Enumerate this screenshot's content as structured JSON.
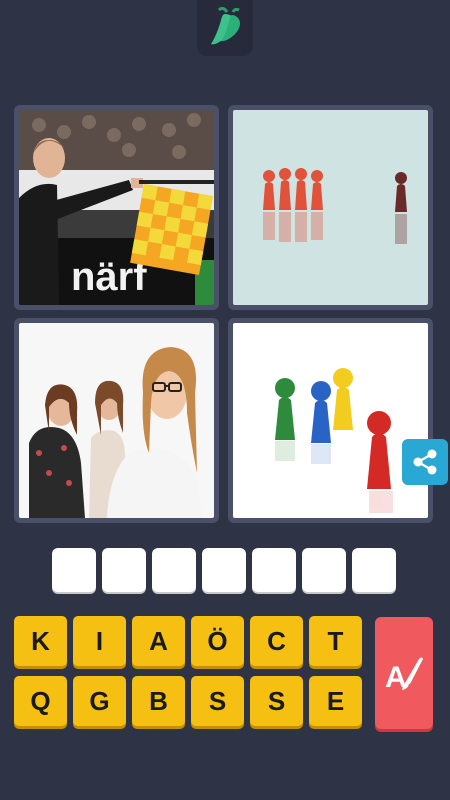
{
  "header": {
    "icon": "chili-pepper-icon"
  },
  "images": [
    {
      "name": "referee-with-flag"
    },
    {
      "name": "red-pawns-and-one-brown-pawn"
    },
    {
      "name": "girl-with-glasses-and-two-girls"
    },
    {
      "name": "colored-game-pawns"
    }
  ],
  "share": {
    "icon": "share-icon"
  },
  "answer": {
    "slot_count": 7,
    "letters": [
      "",
      "",
      "",
      "",
      "",
      "",
      ""
    ]
  },
  "keyboard": {
    "row1": [
      "K",
      "I",
      "A",
      "Ö",
      "C",
      "T"
    ],
    "row2": [
      "Q",
      "G",
      "B",
      "S",
      "S",
      "E"
    ]
  },
  "hint": {
    "icon": "magic-letter-hint-icon",
    "glyph": "A"
  },
  "colors": {
    "background": "#2f3346",
    "key": "#f5c012",
    "hint": "#f0595d",
    "share": "#2aa8d4"
  }
}
